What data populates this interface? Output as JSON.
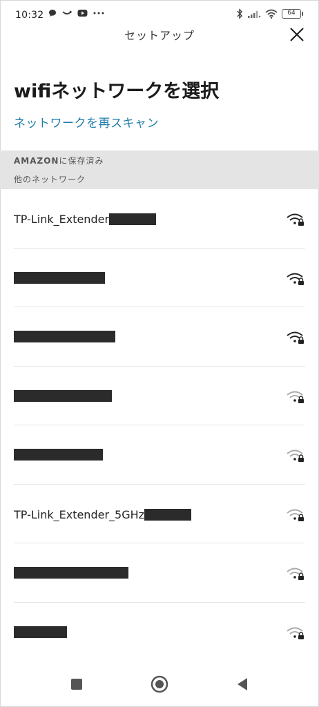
{
  "status_bar": {
    "time": "10:32",
    "battery": "64",
    "left_icons": [
      "chat-icon",
      "amazon-smile-icon",
      "youtube-icon",
      "more-dots-icon"
    ],
    "right_icons": [
      "bluetooth-icon",
      "signal-icon",
      "wifi-icon",
      "battery-icon"
    ]
  },
  "header": {
    "title": "セットアップ",
    "close_icon": "close-icon"
  },
  "page": {
    "title_en": "wifi",
    "title_jp": "ネットワークを選択",
    "rescan_label": "ネットワークを再スキャン"
  },
  "sections": {
    "saved_en": "AMAZON",
    "saved_jp": "に保存済み",
    "other": "他のネットワーク"
  },
  "networks": [
    {
      "name": "TP-Link_Extender",
      "redacted": true,
      "signal": "strong",
      "secured": true
    },
    {
      "name": "",
      "redacted": true,
      "signal": "strong",
      "secured": true
    },
    {
      "name": "",
      "redacted": true,
      "signal": "strong",
      "secured": true
    },
    {
      "name": "",
      "redacted": true,
      "signal": "weak",
      "secured": true
    },
    {
      "name": "",
      "redacted": true,
      "signal": "weak",
      "secured": true
    },
    {
      "name": "TP-Link_Extender_5GHz",
      "redacted": true,
      "signal": "weak",
      "secured": true
    },
    {
      "name": "",
      "redacted": true,
      "signal": "weak",
      "secured": true
    },
    {
      "name": "",
      "redacted": true,
      "signal": "weak",
      "secured": true
    }
  ],
  "nav": [
    "recent-apps-icon",
    "home-icon",
    "back-icon"
  ],
  "colors": {
    "link": "#1f7dab",
    "section_bg": "#e4e4e4",
    "redaction": "#2b2b2b"
  }
}
